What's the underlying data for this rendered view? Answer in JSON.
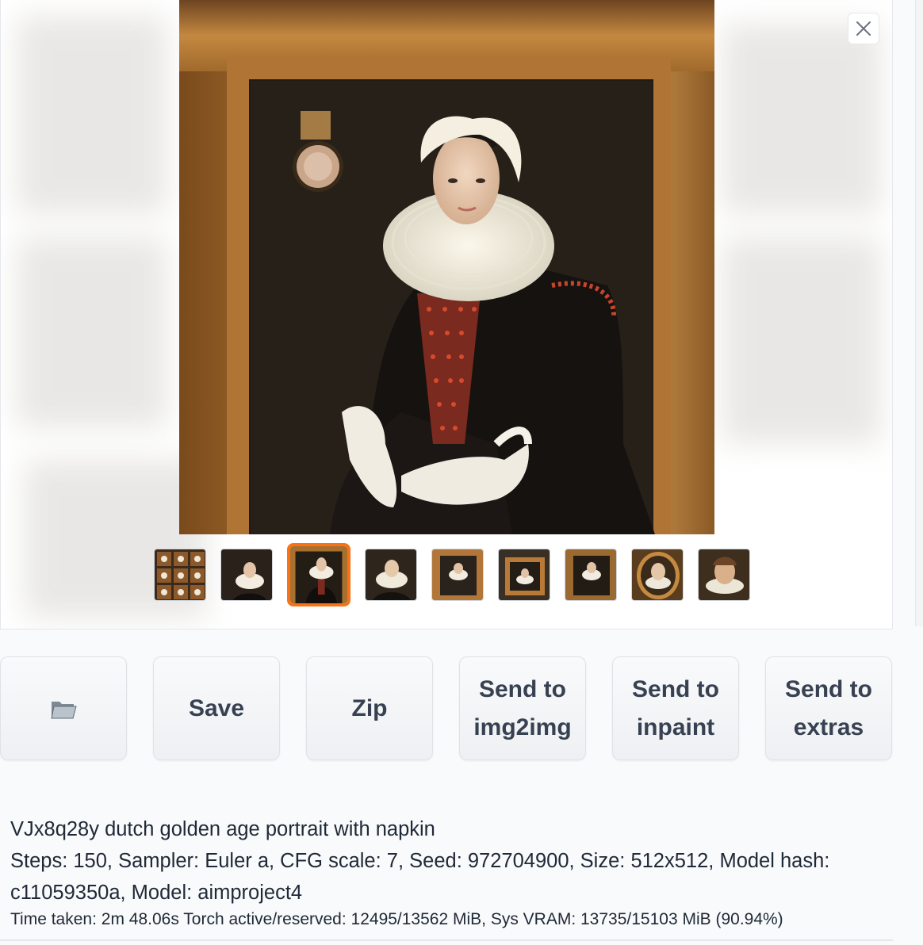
{
  "gallery": {
    "close_icon": "close-icon",
    "thumbnails": [
      {
        "kind": "grid",
        "selected": false
      },
      {
        "kind": "portrait",
        "selected": false
      },
      {
        "kind": "portrait",
        "selected": true
      },
      {
        "kind": "portrait",
        "selected": false
      },
      {
        "kind": "framed",
        "selected": false
      },
      {
        "kind": "framed",
        "selected": false
      },
      {
        "kind": "framed",
        "selected": false
      },
      {
        "kind": "oval",
        "selected": false
      },
      {
        "kind": "portrait-light",
        "selected": false
      }
    ],
    "accent_color": "#f97316"
  },
  "buttons": {
    "folder_icon": "folder-icon",
    "save": "Save",
    "zip": "Zip",
    "img2img_line1": "Send to",
    "img2img_line2": "img2img",
    "inpaint_line1": "Send to",
    "inpaint_line2": "inpaint",
    "extras_line1": "Send to",
    "extras_line2": "extras"
  },
  "info": {
    "prompt": "VJx8q28y dutch golden age portrait with napkin",
    "params": "Steps: 150, Sampler: Euler a, CFG scale: 7, Seed: 972704900, Size: 512x512, Model hash: c11059350a, Model: aimproject4",
    "timing": "Time taken: 2m 48.06s  Torch active/reserved: 12495/13562 MiB, Sys VRAM: 13735/15103 MiB (90.94%)"
  }
}
